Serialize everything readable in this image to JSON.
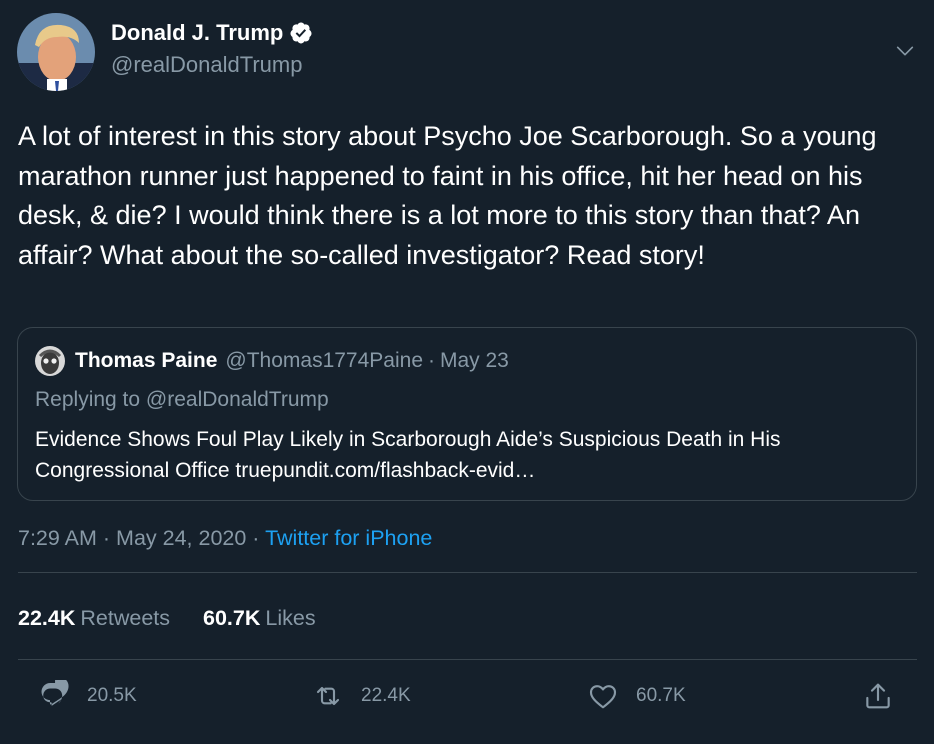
{
  "author": {
    "display_name": "Donald J. Trump",
    "handle": "@realDonaldTrump"
  },
  "tweet": {
    "text": "A lot of interest in this story about Psycho Joe Scarborough. So a young marathon runner just happened to faint in his office, hit her head on his desk, & die? I would think there is a lot more to this story than that? An affair? What about the so-called investigator? Read story!"
  },
  "quote": {
    "display_name": "Thomas Paine",
    "handle": "@Thomas1774Paine",
    "separator": "·",
    "date": "May 23",
    "replying_prefix": "Replying to",
    "replying_to": "@realDonaldTrump",
    "text": "Evidence Shows Foul Play Likely in Scarborough Aide’s Suspicious Death in His Congressional Office truepundit.com/flashback-evid…"
  },
  "meta": {
    "time": "7:29 AM",
    "sep1": "·",
    "date": "May 24, 2020",
    "sep2": "·",
    "source": "Twitter for iPhone"
  },
  "stats": {
    "retweets_count": "22.4K",
    "retweets_label": "Retweets",
    "likes_count": "60.7K",
    "likes_label": "Likes"
  },
  "actions": {
    "reply_count": "20.5K",
    "retweet_count": "22.4K",
    "like_count": "60.7K"
  },
  "icons": {
    "verified": "verified-badge-icon",
    "caret": "chevron-down-icon",
    "reply": "reply-icon",
    "retweet": "retweet-icon",
    "like": "heart-icon",
    "share": "share-icon"
  },
  "colors": {
    "background": "#15202b",
    "secondary_text": "#8899a6",
    "link": "#1da1f2",
    "border": "#38444d"
  }
}
